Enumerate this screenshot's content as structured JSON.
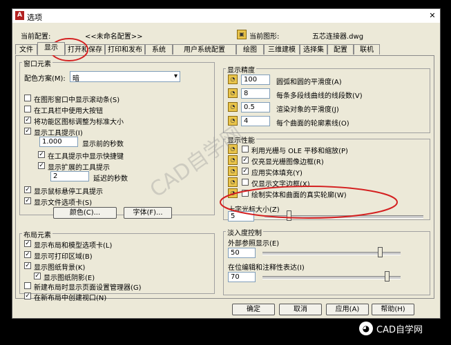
{
  "window": {
    "title": "选项",
    "close_glyph": "✕"
  },
  "header": {
    "current_profile_label": "当前配置:",
    "current_profile_value": "<<未命名配置>>",
    "current_drawing_label": "当前图形:",
    "current_drawing_value": "五芯连接器.dwg"
  },
  "tabs": [
    "文件",
    "显示",
    "打开和保存",
    "打印和发布",
    "系统",
    "用户系统配置",
    "绘图",
    "三维建模",
    "选择集",
    "配置",
    "联机"
  ],
  "window_elements": {
    "title": "窗口元素",
    "color_scheme_label": "配色方案(M):",
    "color_scheme_value": "暗",
    "checkboxes": [
      {
        "label": "在图形窗口中显示滚动条(S)",
        "checked": false
      },
      {
        "label": "在工具栏中使用大按钮",
        "checked": false
      },
      {
        "label": "将功能区图标调整为标准大小",
        "checked": true
      },
      {
        "label": "显示工具提示(I)",
        "checked": true
      },
      {
        "label": "在工具提示中显示快捷键",
        "checked": true
      },
      {
        "label": "显示扩展的工具提示",
        "checked": true
      },
      {
        "label": "显示鼠标悬停工具提示",
        "checked": true
      },
      {
        "label": "显示文件选项卡(S)",
        "checked": true
      }
    ],
    "tooltip_delay_value": "1.000",
    "tooltip_delay_label": "显示前的秒数",
    "ext_delay_value": "2",
    "ext_delay_label": "延迟的秒数",
    "colors_button": "颜色(C)...",
    "fonts_button": "字体(F)..."
  },
  "layout_elements": {
    "title": "布局元素",
    "checkboxes": [
      {
        "label": "显示布局和模型选项卡(L)",
        "checked": true
      },
      {
        "label": "显示可打印区域(B)",
        "checked": true
      },
      {
        "label": "显示图纸背景(K)",
        "checked": true
      },
      {
        "label": "显示图纸阴影(E)",
        "checked": true
      },
      {
        "label": "新建布局时显示页面设置管理器(G)",
        "checked": false
      },
      {
        "label": "在新布局中创建视口(N)",
        "checked": true
      }
    ]
  },
  "display_resolution": {
    "title": "显示精度",
    "rows": [
      {
        "value": "100",
        "label": "圆弧和圆的平滑度(A)"
      },
      {
        "value": "8",
        "label": "每条多段线曲线的线段数(V)"
      },
      {
        "value": "0.5",
        "label": "渲染对象的平滑度(J)"
      },
      {
        "value": "4",
        "label": "每个曲面的轮廓素线(O)"
      }
    ]
  },
  "display_performance": {
    "title": "显示性能",
    "checkboxes": [
      {
        "label": "利用光栅与 OLE 平移和缩放(P)",
        "checked": false
      },
      {
        "label": "仅亮显光栅图像边框(R)",
        "checked": true
      },
      {
        "label": "应用实体填充(Y)",
        "checked": true
      },
      {
        "label": "仅显示文字边框(X)",
        "checked": false
      },
      {
        "label": "绘制实体和曲面的真实轮廓(W)",
        "checked": false
      }
    ]
  },
  "crosshair": {
    "label": "十字光标大小(Z)",
    "value": "5",
    "fraction": 0.05
  },
  "fade_control": {
    "title": "淡入度控制",
    "xref_label": "外部参照显示(E)",
    "xref_value": "50",
    "xref_fraction": 0.5,
    "inplace_label": "在位编辑和注释性表达(I)",
    "inplace_value": "70",
    "inplace_fraction": 0.7
  },
  "footer": {
    "ok": "确定",
    "cancel": "取消",
    "apply": "应用(A)",
    "help": "帮助(H)"
  },
  "watermark": {
    "diagonal": "CAD自学网",
    "corner": "CAD自学网"
  }
}
